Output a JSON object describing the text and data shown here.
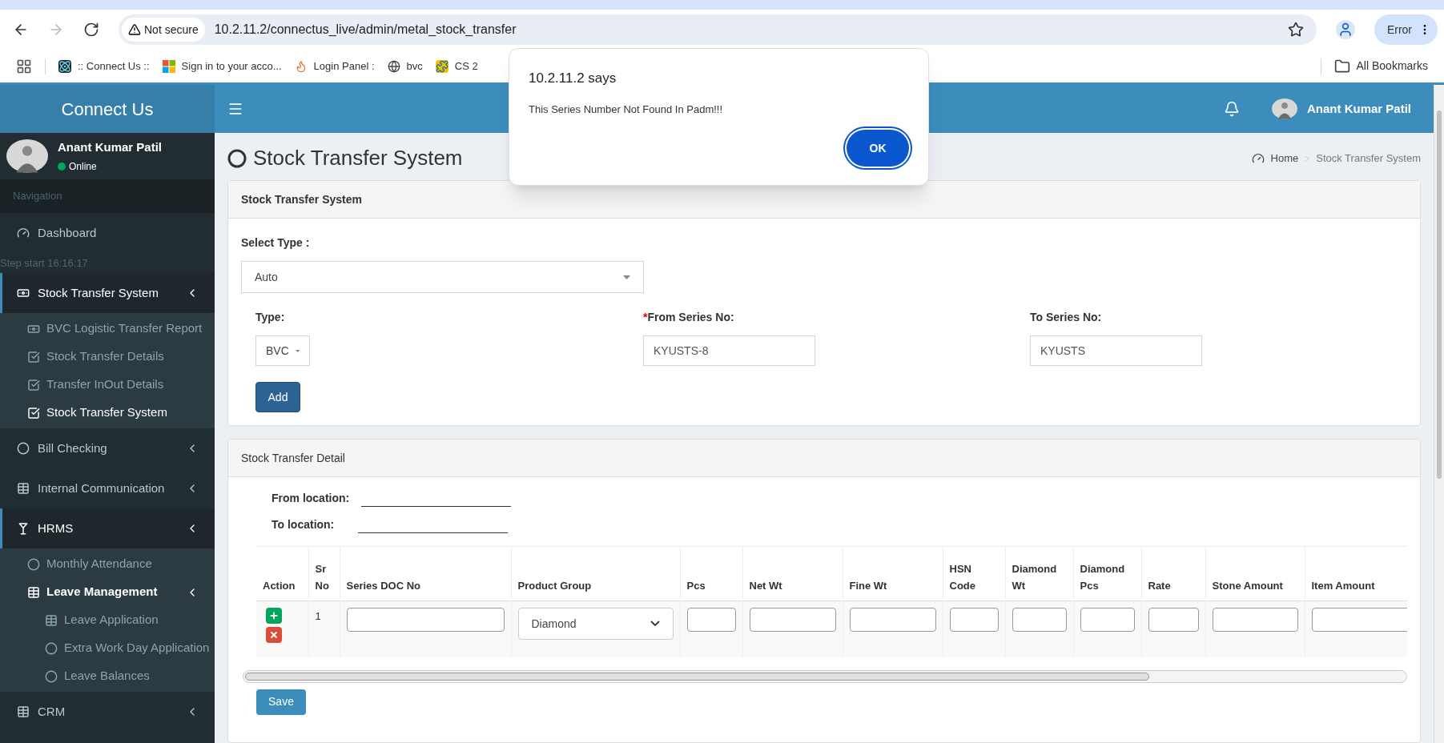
{
  "browser": {
    "forward_disabled": true,
    "security_label": "Not secure",
    "url": "10.2.11.2/connectus_live/admin/metal_stock_transfer",
    "profile_status": "Error",
    "bookmarks": [
      {
        "kind": "atom",
        "label": ":: Connect Us ::"
      },
      {
        "kind": "windows",
        "label": "Sign in to your acco..."
      },
      {
        "kind": "flame",
        "label": "Login Panel :"
      },
      {
        "kind": "globe",
        "label": "bvc"
      },
      {
        "kind": "puzzle",
        "label": "CS 2"
      }
    ],
    "all_bookmarks": "All Bookmarks"
  },
  "dialog": {
    "title": "10.2.11.2 says",
    "message": "This Series Number Not Found In Padm!!!",
    "button": "OK"
  },
  "sidebar": {
    "brand": "Connect Us",
    "user": {
      "name": "Anant Kumar Patil",
      "status": "Online",
      "online": true
    },
    "nav_header": "Navigation",
    "overlay_note": "Step start 16:16:17",
    "menu": [
      {
        "label": "Dashboard",
        "kind": "gauge"
      },
      {
        "label": "Stock Transfer System",
        "kind": "money",
        "expanded": true,
        "children": [
          {
            "label": "BVC Logistic Transfer Report",
            "kind": "money",
            "selected": false
          },
          {
            "label": "Stock Transfer Details",
            "kind": "check",
            "selected": false
          },
          {
            "label": "Transfer InOut Details",
            "kind": "check",
            "selected": false
          },
          {
            "label": "Stock Transfer System",
            "kind": "check",
            "selected": true
          }
        ]
      },
      {
        "label": "Bill Checking",
        "kind": "circle",
        "expanded": false
      },
      {
        "label": "Internal Communication",
        "kind": "table",
        "expanded": false
      },
      {
        "label": "HRMS",
        "kind": "glass",
        "expanded": true,
        "children": [
          {
            "label": "Monthly Attendance",
            "kind": "circle",
            "selected": false
          },
          {
            "label": "Leave Management",
            "kind": "table",
            "selected": false,
            "expanded": true,
            "children": [
              {
                "label": "Leave Application",
                "kind": "table",
                "selected": false
              },
              {
                "label": "Extra Work Day Application",
                "kind": "circle",
                "selected": false
              },
              {
                "label": "Leave Balances",
                "kind": "circle",
                "selected": false
              }
            ]
          }
        ]
      },
      {
        "label": "CRM",
        "kind": "table",
        "expanded": false
      }
    ]
  },
  "header": {
    "user_name": "Anant Kumar Patil"
  },
  "page": {
    "title": "Stock Transfer System",
    "breadcrumb": [
      "Home",
      "Stock Transfer System"
    ]
  },
  "form": {
    "title": "Stock Transfer System",
    "select_type": {
      "label": "Select Type :",
      "value": "Auto"
    },
    "type": {
      "label": "Type:",
      "value": "BVC"
    },
    "from_series": {
      "required_mark": "*",
      "label": "From Series No:",
      "value": "KYUSTS-8"
    },
    "to_series": {
      "label": "To Series No:",
      "value": "KYUSTS"
    },
    "add_button": "Add"
  },
  "detail": {
    "title": "Stock Transfer Detail",
    "from_location": {
      "label": "From location:"
    },
    "to_location": {
      "label": "To location:"
    },
    "columns": [
      {
        "label": "Action",
        "kind": "action"
      },
      {
        "label": "Sr No",
        "kind": "sr"
      },
      {
        "label": "Series DOC No",
        "kind": "input"
      },
      {
        "label": "Product Group",
        "kind": "select"
      },
      {
        "label": "Pcs",
        "kind": "input"
      },
      {
        "label": "Net Wt",
        "kind": "input"
      },
      {
        "label": "Fine Wt",
        "kind": "input"
      },
      {
        "label": "HSN Code",
        "kind": "input"
      },
      {
        "label": "Diamond Wt",
        "kind": "input"
      },
      {
        "label": "Diamond Pcs",
        "kind": "input"
      },
      {
        "label": "Rate",
        "kind": "input"
      },
      {
        "label": "Stone Amount",
        "kind": "input"
      },
      {
        "label": "Item Amount",
        "kind": "input"
      }
    ],
    "rows": [
      {
        "sr_no": "1",
        "product_group": "Diamond"
      }
    ],
    "save_button": "Save"
  }
}
